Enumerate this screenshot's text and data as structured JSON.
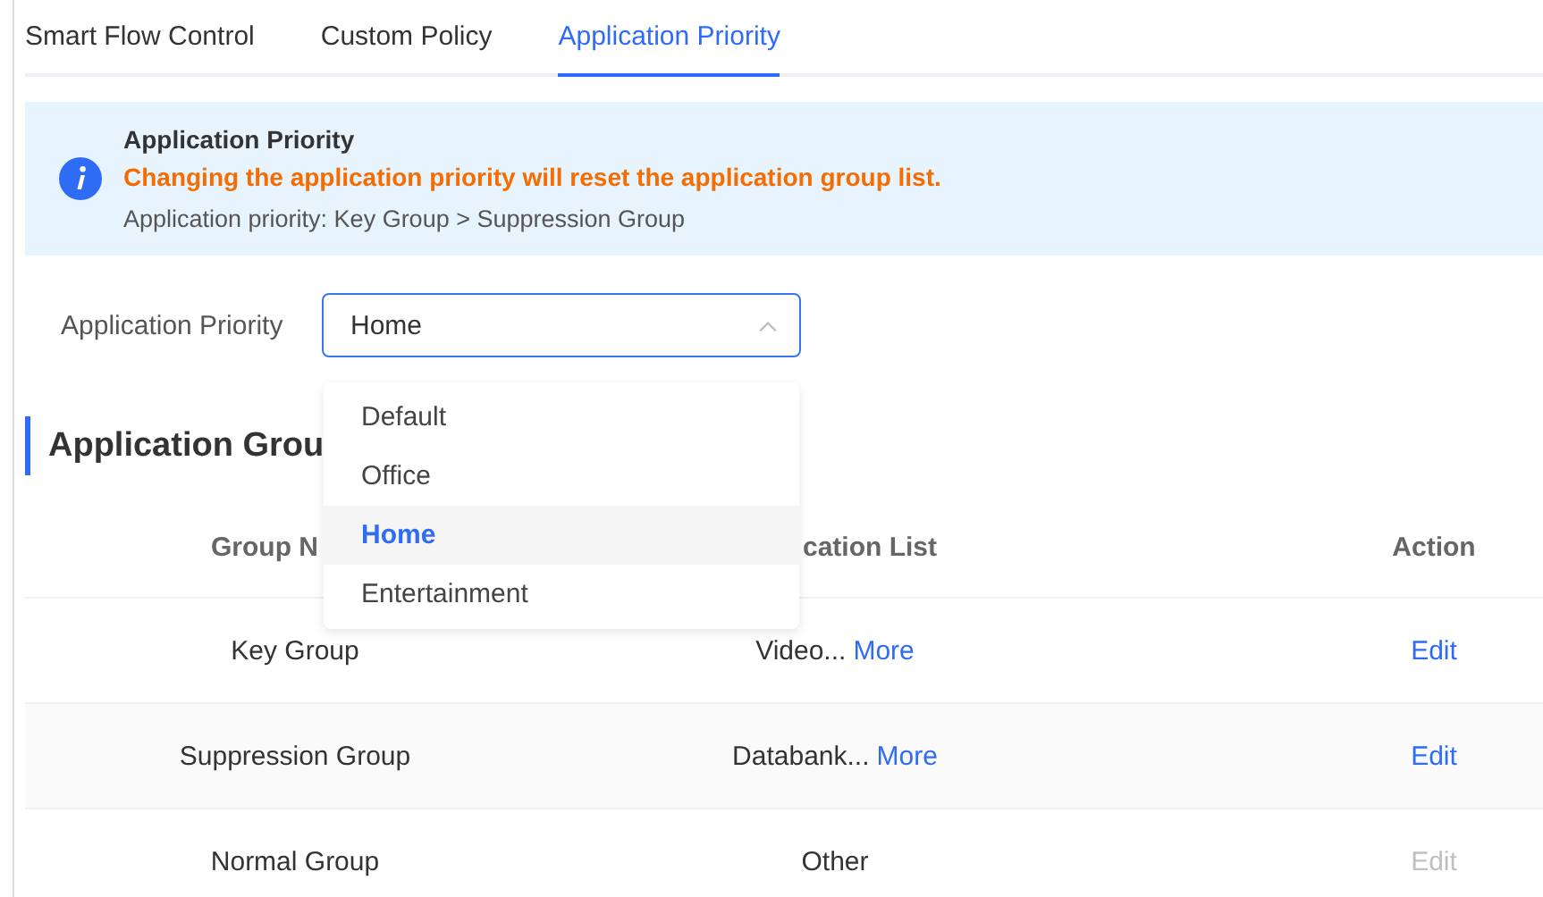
{
  "tabs": [
    {
      "label": "Smart Flow Control",
      "selected": false
    },
    {
      "label": "Custom Policy",
      "selected": false
    },
    {
      "label": "Application Priority",
      "selected": true
    }
  ],
  "alert": {
    "title": "Application Priority",
    "warning": "Changing the application priority will reset the application group list.",
    "detail": "Application priority: Key Group > Suppression Group"
  },
  "priority": {
    "label": "Application Priority",
    "value": "Home",
    "open": true,
    "options": [
      {
        "label": "Default",
        "selected": false
      },
      {
        "label": "Office",
        "selected": false
      },
      {
        "label": "Home",
        "selected": true
      },
      {
        "label": "Entertainment",
        "selected": false
      }
    ]
  },
  "section": {
    "title": "Application Grou"
  },
  "table": {
    "columns": [
      "Group N",
      "cation List",
      "Action"
    ],
    "rows": [
      {
        "group": "Key Group",
        "apps": "Video...",
        "more": "More",
        "action": "Edit",
        "disabled": false
      },
      {
        "group": "Suppression Group",
        "apps": "Databank...",
        "more": "More",
        "action": "Edit",
        "disabled": false
      },
      {
        "group": "Normal Group",
        "apps": "Other",
        "action": "Edit",
        "disabled": true
      }
    ]
  }
}
